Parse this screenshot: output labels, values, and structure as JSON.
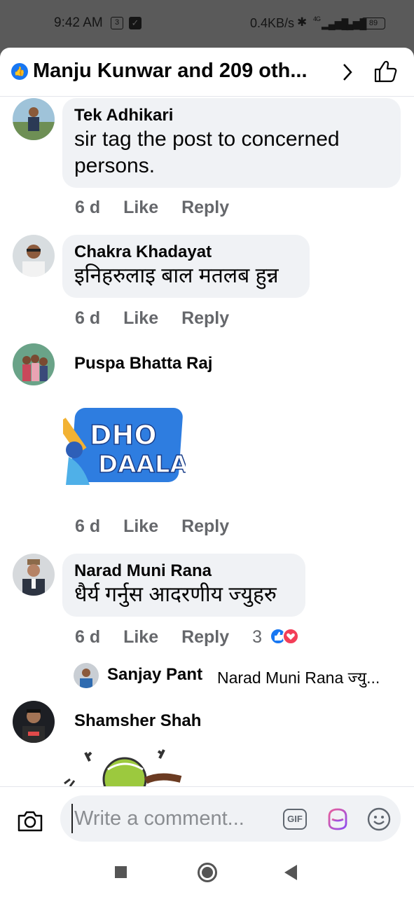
{
  "status_bar": {
    "time": "9:42 AM",
    "badge_number": "3",
    "network_speed": "0.4KB/s",
    "signal_label": "4G",
    "battery": "89"
  },
  "header": {
    "title": "Manju Kunwar and 209 oth...",
    "icons": [
      "like-badge-icon",
      "chevron-right-icon",
      "thumbs-up-icon"
    ]
  },
  "comments": [
    {
      "name": "Tek Adhikari",
      "text": "sir tag the post to concerned persons.",
      "time": "6 d",
      "like": "Like",
      "reply": "Reply"
    },
    {
      "name": "Chakra Khadayat",
      "text": "इनिहरुलाइ बाल मतलब हुन्न",
      "time": "6 d",
      "like": "Like",
      "reply": "Reply"
    },
    {
      "name": "Puspa Bhatta Raj",
      "sticker": {
        "line1": "DHO",
        "line2": "DAALA"
      },
      "time": "6 d",
      "like": "Like",
      "reply": "Reply"
    },
    {
      "name": "Narad Muni Rana",
      "text": "धैर्य गर्नुस आदरणीय ज्युहरु",
      "time": "6 d",
      "like": "Like",
      "reply": "Reply",
      "reaction_count": "3",
      "reply_preview": {
        "name": "Sanjay Pant",
        "text": "Narad Muni Rana ज्यु..."
      }
    },
    {
      "name": "Shamsher Shah"
    }
  ],
  "composer": {
    "placeholder": "Write a comment...",
    "gif_label": "GIF"
  },
  "colors": {
    "accent": "#1877f2",
    "bubble": "#f0f2f5",
    "secondary_text": "#65676b",
    "love": "#f33e58"
  }
}
